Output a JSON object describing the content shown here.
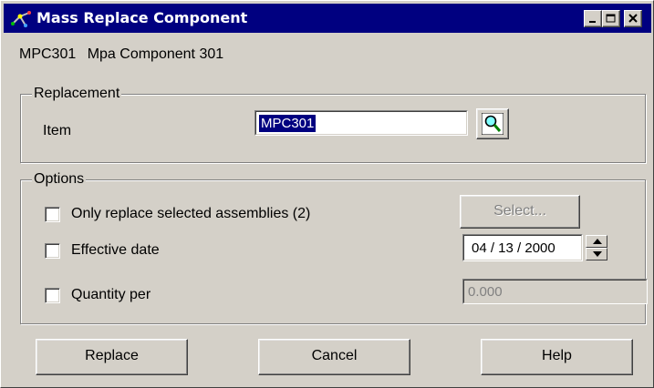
{
  "window": {
    "title": "Mass Replace Component",
    "minimize_icon": "minimize-icon",
    "maximize_icon": "maximize-icon",
    "close_icon": "close-icon"
  },
  "component": {
    "code": "MPC301",
    "name": "Mpa Component 301"
  },
  "replacement": {
    "legend": "Replacement",
    "item_label": "Item",
    "item_value": "MPC301",
    "lookup_icon": "magnifier-icon"
  },
  "options": {
    "legend": "Options",
    "only_selected_label": "Only replace selected assemblies (2)",
    "only_selected_checked": false,
    "select_button": "Select...",
    "effective_date_label": "Effective date",
    "effective_date_checked": false,
    "effective_date_value": "04 / 13 / 2000",
    "quantity_label": "Quantity per",
    "quantity_checked": false,
    "quantity_value": "0.000"
  },
  "buttons": {
    "replace": "Replace",
    "cancel": "Cancel",
    "help": "Help"
  },
  "colors": {
    "titlebar": "#000080",
    "dialog_face": "#d4d0c8",
    "selection": "#000080"
  }
}
